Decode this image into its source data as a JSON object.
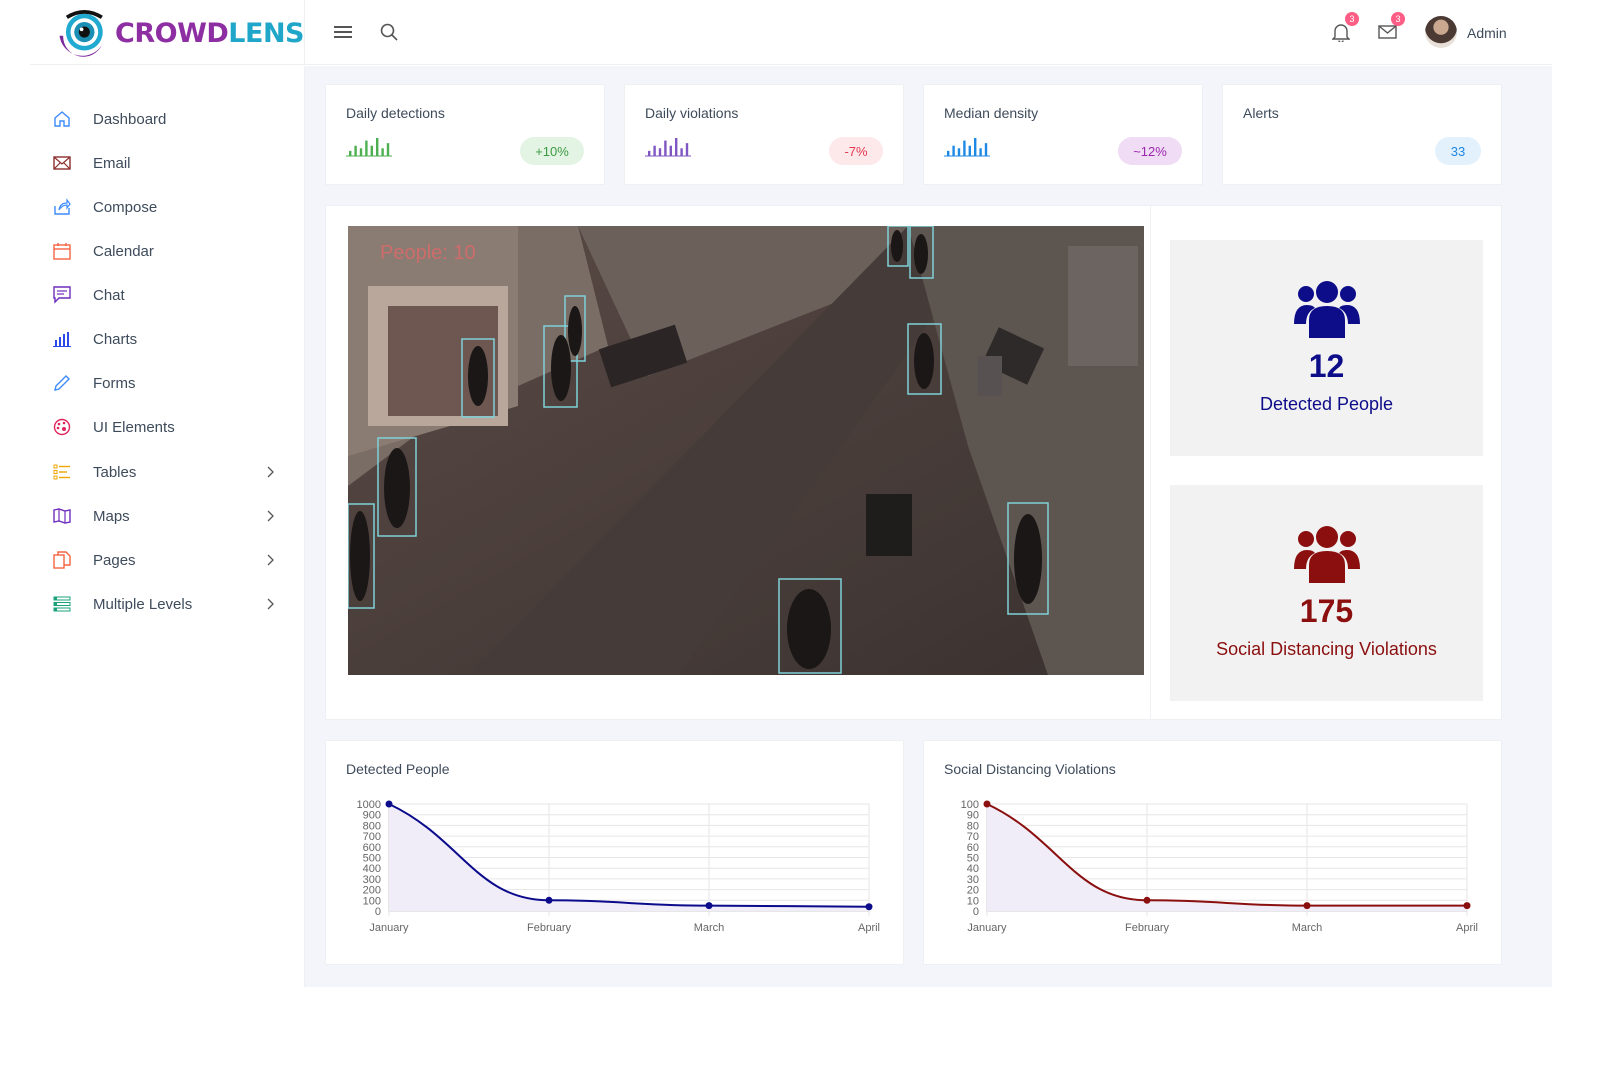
{
  "brand": {
    "part1": "CROWD",
    "part2": "LENS"
  },
  "header": {
    "menu_icon": "hamburger-icon",
    "search_icon": "search-icon",
    "notifications_count": "3",
    "messages_count": "3",
    "user_name": "Admin"
  },
  "sidebar": {
    "items": [
      {
        "label": "Dashboard",
        "icon": "home-icon",
        "color": "#3d8bfd"
      },
      {
        "label": "Email",
        "icon": "envelope-icon",
        "color": "#8b2d2d"
      },
      {
        "label": "Compose",
        "icon": "share-icon",
        "color": "#3d8bfd"
      },
      {
        "label": "Calendar",
        "icon": "calendar-icon",
        "color": "#f56342"
      },
      {
        "label": "Chat",
        "icon": "chat-icon",
        "color": "#6f2dbd"
      },
      {
        "label": "Charts",
        "icon": "bar-chart-icon",
        "color": "#2c4be6"
      },
      {
        "label": "Forms",
        "icon": "pencil-icon",
        "color": "#3d8bfd"
      },
      {
        "label": "UI Elements",
        "icon": "palette-icon",
        "color": "#e0245e"
      },
      {
        "label": "Tables",
        "icon": "list-icon",
        "color": "#f0a500"
      },
      {
        "label": "Maps",
        "icon": "map-icon",
        "color": "#6f2dbd"
      },
      {
        "label": "Pages",
        "icon": "copy-icon",
        "color": "#f56342"
      },
      {
        "label": "Multiple Levels",
        "icon": "layers-icon",
        "color": "#1aa37a"
      }
    ]
  },
  "stats": [
    {
      "title": "Daily detections",
      "change": "+10%",
      "color": "#4caf50",
      "pill_bg": "#e3f4e4",
      "bars": [
        2,
        4,
        3,
        6,
        4,
        7,
        3,
        5
      ]
    },
    {
      "title": "Daily violations",
      "change": "-7%",
      "color": "#7e57c2",
      "pill_bg": "#fde8ea",
      "pill_text": "#e53950",
      "bars": [
        2,
        4,
        3,
        6,
        4,
        7,
        3,
        5
      ]
    },
    {
      "title": "Median density",
      "change": "~12%",
      "color": "#1e88e5",
      "pill_bg": "#f0dcf5",
      "pill_text": "#9b27af",
      "bars": [
        2,
        4,
        3,
        6,
        4,
        7,
        3,
        5
      ]
    },
    {
      "title": "Alerts",
      "change": "33",
      "pill_bg": "#e3f1fd",
      "pill_text": "#1e88e5"
    }
  ],
  "video": {
    "overlay_text": "People: 10"
  },
  "metrics": [
    {
      "value": "12",
      "label": "Detected People",
      "color": "#0d0d8a",
      "icon": "users-icon"
    },
    {
      "value": "175",
      "label": "Social Distancing Violations",
      "color": "#8b0f0f",
      "icon": "users-icon"
    }
  ],
  "chart_data": [
    {
      "type": "line",
      "title": "Detected People",
      "categories": [
        "January",
        "February",
        "March",
        "April"
      ],
      "series": [
        {
          "values": [
            1000,
            100,
            50,
            40
          ],
          "color": "#0b0b8c"
        }
      ],
      "yticks": [
        0,
        100,
        200,
        300,
        400,
        500,
        600,
        700,
        800,
        900,
        1000
      ],
      "ylim": [
        0,
        1000
      ],
      "grid": true,
      "area_fill": "#f0ecf8"
    },
    {
      "type": "line",
      "title": "Social Distancing Violations",
      "categories": [
        "January",
        "February",
        "March",
        "April"
      ],
      "series": [
        {
          "values": [
            100,
            10,
            5,
            5
          ],
          "color": "#8b0f0f"
        }
      ],
      "yticks": [
        0,
        10,
        20,
        30,
        40,
        50,
        60,
        70,
        80,
        90,
        100
      ],
      "ylim": [
        0,
        100
      ],
      "grid": true,
      "area_fill": "#f0ecf8"
    }
  ]
}
